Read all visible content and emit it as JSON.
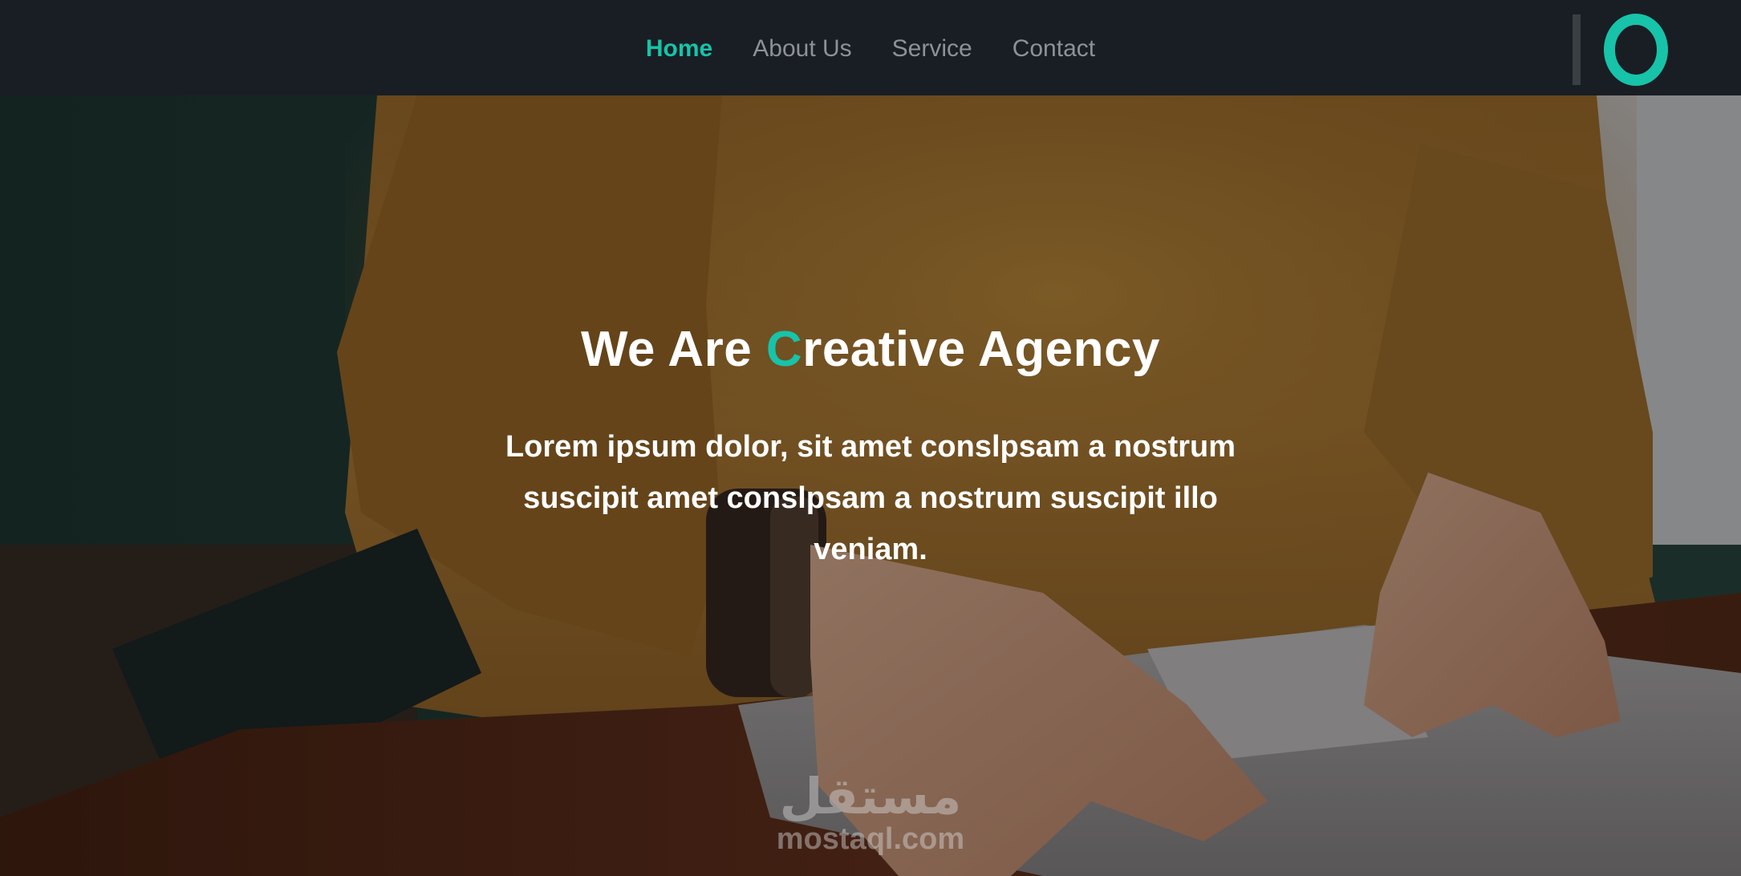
{
  "nav": {
    "items": [
      {
        "label": "Home",
        "active": true
      },
      {
        "label": "About Us",
        "active": false
      },
      {
        "label": "Service",
        "active": false
      },
      {
        "label": "Contact",
        "active": false
      }
    ],
    "logo_icon": "brand-logo-icon"
  },
  "hero": {
    "title_part1": "We Are ",
    "title_accent": "C",
    "title_part2": "reative Agency",
    "text": "Lorem ipsum dolor, sit amet conslpsam a nostrum suscipit amet conslpsam a nostrum suscipit illo veniam.",
    "background": "photo-person-typing-laptop"
  },
  "watermark": {
    "arabic": "مستقل",
    "latin": "mostaql.com"
  },
  "colors": {
    "accent": "#17c3a9",
    "navbar_bg": "#191e24",
    "nav_text": "#8e9195",
    "hero_text": "#ffffff"
  }
}
